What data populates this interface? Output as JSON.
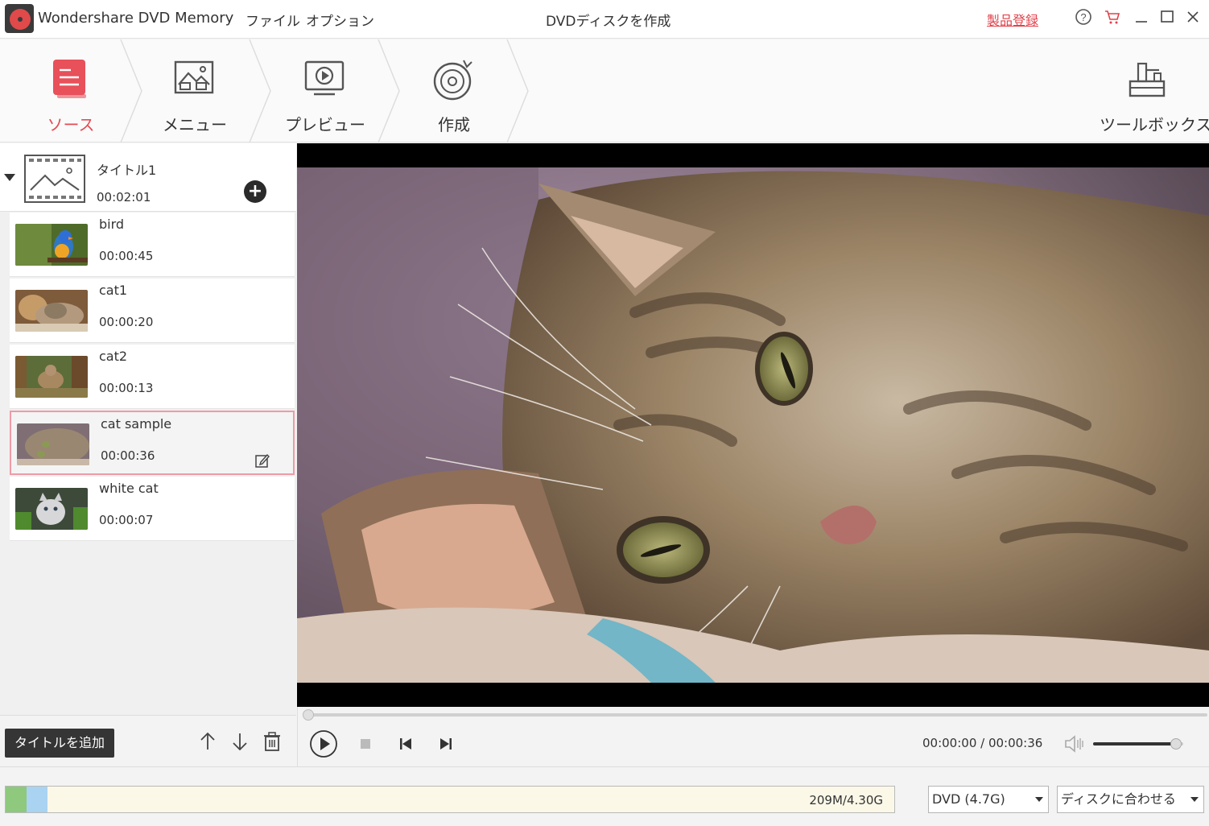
{
  "titlebar": {
    "app_name": "Wondershare DVD Memory",
    "menu": [
      "ファイル",
      "オプション"
    ],
    "window_title": "DVDディスクを作成",
    "register_link": "製品登録"
  },
  "steps": [
    {
      "label": "ソース",
      "icon": "source-icon",
      "active": true
    },
    {
      "label": "メニュー",
      "icon": "menu-image-icon",
      "active": false
    },
    {
      "label": "プレビュー",
      "icon": "preview-icon",
      "active": false
    },
    {
      "label": "作成",
      "icon": "burn-disc-icon",
      "active": false
    }
  ],
  "toolbox": {
    "label": "ツールボックス",
    "icon": "toolbox-icon"
  },
  "title_group": {
    "name": "タイトル1",
    "duration": "00:02:01"
  },
  "clips": [
    {
      "name": "bird",
      "duration": "00:00:45",
      "selected": false
    },
    {
      "name": "cat1",
      "duration": "00:00:20",
      "selected": false
    },
    {
      "name": "cat2",
      "duration": "00:00:13",
      "selected": false
    },
    {
      "name": "cat sample",
      "duration": "00:00:36",
      "selected": true
    },
    {
      "name": "white cat",
      "duration": "00:00:07",
      "selected": false
    }
  ],
  "left_actions": {
    "add_title": "タイトルを追加"
  },
  "player": {
    "time": "00:00:00 / 00:00:36",
    "progress": 0.0,
    "volume": 0.92
  },
  "capacity": {
    "used_text": "209M/4.30G",
    "video_fraction": 0.024,
    "menu_fraction": 0.023
  },
  "disc_type": "DVD (4.7G)",
  "fit_mode": "ディスクに合わせる",
  "colors": {
    "accent": "#e44c55",
    "capacity_video": "#8ec97d",
    "capacity_menu": "#a9d3f1"
  }
}
